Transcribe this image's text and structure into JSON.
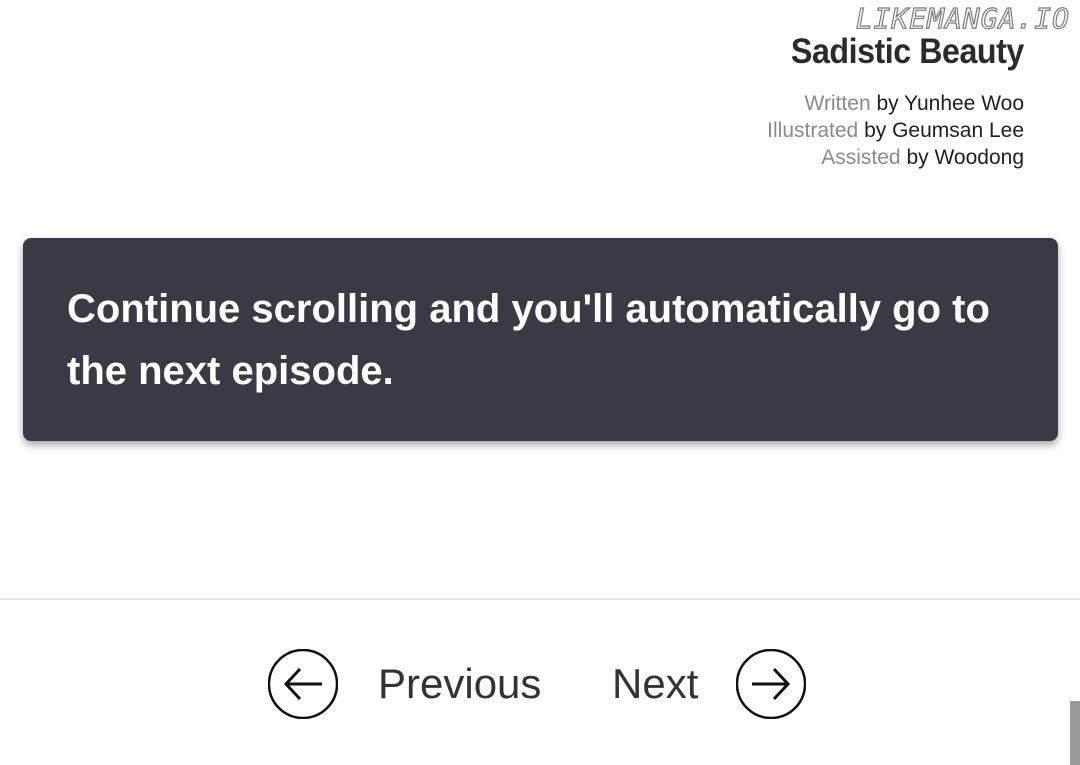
{
  "credits": {
    "watermark": "LIKEMANGA.IO",
    "series_title": "Sadistic Beauty",
    "lines": [
      {
        "role": "Written",
        "by": "by Yunhee Woo"
      },
      {
        "role": "Illustrated",
        "by": "by Geumsan Lee"
      },
      {
        "role": "Assisted",
        "by": "by Woodong"
      }
    ]
  },
  "notice": {
    "text": "Continue scrolling and you'll automatically go to the next episode."
  },
  "nav": {
    "previous_label": "Previous",
    "next_label": "Next",
    "previous_icon": "arrow-left-circle-icon",
    "next_icon": "arrow-right-circle-icon"
  },
  "colors": {
    "notice_bg": "#383b44",
    "notice_text": "#ffffff",
    "nav_text": "#333333",
    "divider": "#e6e6e6",
    "scroll_thumb": "#9a9a9a"
  }
}
